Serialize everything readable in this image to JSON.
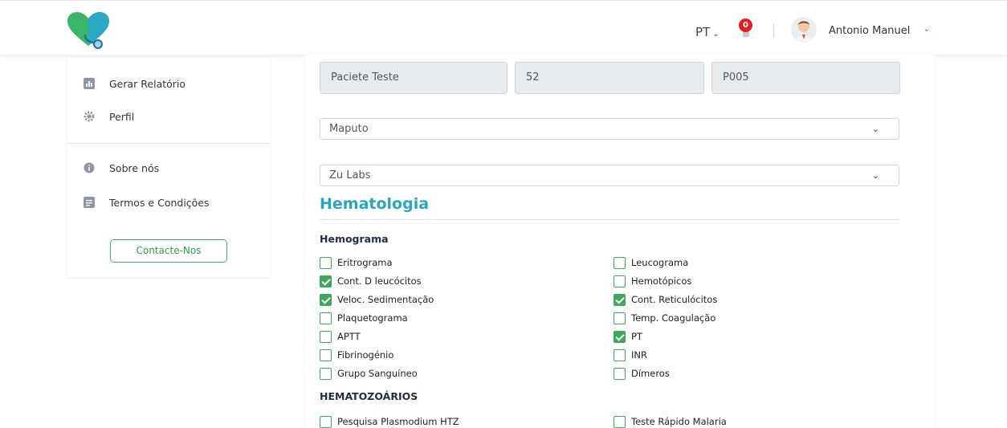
{
  "header": {
    "language": "PT",
    "notification_count": "0",
    "user_name": "Antonio Manuel"
  },
  "sidebar": {
    "items": [
      {
        "label": "Gerar Relatório",
        "icon": "chart-icon"
      },
      {
        "label": "Perfil",
        "icon": "gear-icon"
      },
      {
        "label": "Sobre nós",
        "icon": "info-icon"
      },
      {
        "label": "Termos e Condições",
        "icon": "document-icon"
      }
    ],
    "contact_button": "Contacte-Nos"
  },
  "form": {
    "patient_name": "Paciete Teste",
    "age": "52",
    "patient_code": "P005",
    "city": "Maputo",
    "lab": "Zu Labs"
  },
  "section": {
    "title": "Hematologia",
    "groups": [
      {
        "title": "Hemograma",
        "tests": [
          {
            "label": "Eritrograma",
            "checked": false
          },
          {
            "label": "Leucograma",
            "checked": false
          },
          {
            "label": "Cont. D leucócitos",
            "checked": true
          },
          {
            "label": "Hemotópicos",
            "checked": false
          },
          {
            "label": "Veloc. Sedimentação",
            "checked": true
          },
          {
            "label": "Cont. Reticulócitos",
            "checked": true
          },
          {
            "label": "Plaquetograma",
            "checked": false
          },
          {
            "label": "Temp. Coagulação",
            "checked": false
          },
          {
            "label": "APTT",
            "checked": false
          },
          {
            "label": "PT",
            "checked": true
          },
          {
            "label": "Fibrinogénio",
            "checked": false
          },
          {
            "label": "INR",
            "checked": false
          },
          {
            "label": "Grupo Sanguíneo",
            "checked": false
          },
          {
            "label": "Dímeros",
            "checked": false
          }
        ]
      },
      {
        "title": "HEMATOZOÁRIOS",
        "tests": [
          {
            "label": "Pesquisa Plasmodium HTZ",
            "checked": false
          },
          {
            "label": "Teste Rápido Malaria",
            "checked": false
          }
        ]
      }
    ]
  },
  "colors": {
    "accent_teal": "#28a8b8",
    "checkbox_green": "#41a85a",
    "notification_red": "#e02020"
  }
}
